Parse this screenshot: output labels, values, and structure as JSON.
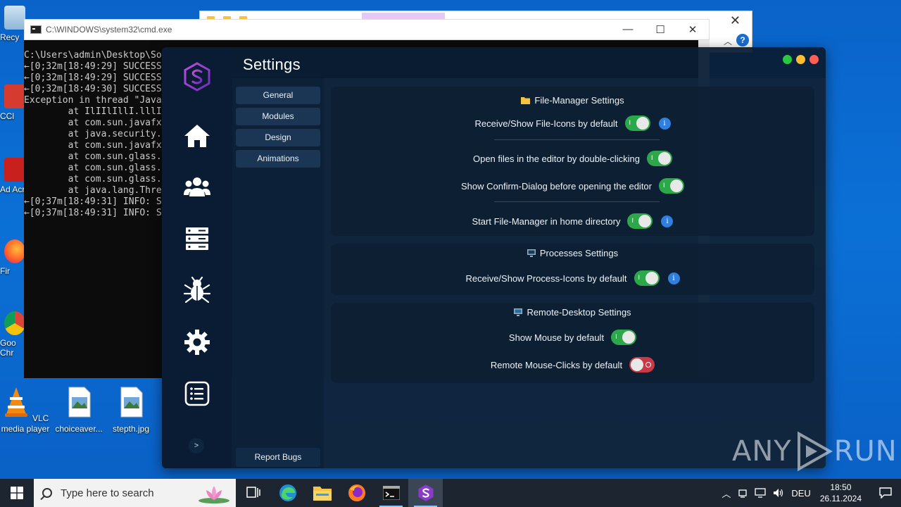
{
  "desktop": {
    "icons": [
      {
        "label": "VLC media player"
      },
      {
        "label": "choiceaver..."
      },
      {
        "label": "stepth.jpg"
      }
    ],
    "partial_labels": [
      "Recy",
      "CCl",
      "Ad Acr",
      "Fir",
      "Goo Chr"
    ]
  },
  "explorer": {
    "close": "✕",
    "help": "?"
  },
  "cmd": {
    "title": "C:\\WINDOWS\\system32\\cmd.exe",
    "minimize": "—",
    "maximize": "☐",
    "close": "✕",
    "lines": [
      "C:\\Users\\admin\\Desktop\\So",
      "←[0;32m[18:49:29] SUCCESS",
      "←[0;32m[18:49:29] SUCCESS",
      "←[0;32m[18:49:30] SUCCESS",
      "Exception in thread \"Java",
      "        at IlIIlIllI.lllI",
      "        at com.sun.javafx",
      "        at java.security.",
      "        at com.sun.javafx",
      "        at com.sun.glass.",
      "        at com.sun.glass.",
      "        at com.sun.glass.",
      "        at java.lang.Thre",
      "←[0;37m[18:49:31] INFO: S",
      "←[0;37m[18:49:31] INFO: S"
    ]
  },
  "app": {
    "title": "Settings",
    "window_dots": [
      "#28c840",
      "#febc2e",
      "#ff5f57"
    ],
    "accent": "#a64dd6",
    "nav_icons": [
      "home-icon",
      "users-icon",
      "server-icon",
      "bug-icon",
      "gear-icon",
      "list-icon"
    ],
    "collapse": ">",
    "sub_nav": [
      "General",
      "Modules",
      "Design",
      "Animations"
    ],
    "report_bugs": "Report Bugs",
    "sections": {
      "file_manager": {
        "title": "File-Manager Settings",
        "rows": [
          {
            "label": "Receive/Show File-Icons by default",
            "on": true,
            "info": true
          },
          {
            "label": "Open files in the editor by double-clicking",
            "on": true,
            "info": false
          },
          {
            "label": "Show Confirm-Dialog before opening the editor",
            "on": true,
            "info": false
          },
          {
            "label": "Start File-Manager in home directory",
            "on": true,
            "info": true
          }
        ]
      },
      "processes": {
        "title": "Processes Settings",
        "rows": [
          {
            "label": "Receive/Show Process-Icons by default",
            "on": true,
            "info": true
          }
        ]
      },
      "remote_desktop": {
        "title": "Remote-Desktop Settings",
        "rows": [
          {
            "label": "Show Mouse by default",
            "on": true,
            "info": false
          },
          {
            "label": "Remote Mouse-Clicks by default",
            "on": false,
            "info": false
          }
        ]
      }
    },
    "toggle_on_mark": "I",
    "info_mark": "i"
  },
  "watermark": {
    "left": "ANY",
    "right": "RUN"
  },
  "taskbar": {
    "search_placeholder": "Type here to search",
    "language": "DEU",
    "time": "18:50",
    "date": "26.11.2024"
  }
}
